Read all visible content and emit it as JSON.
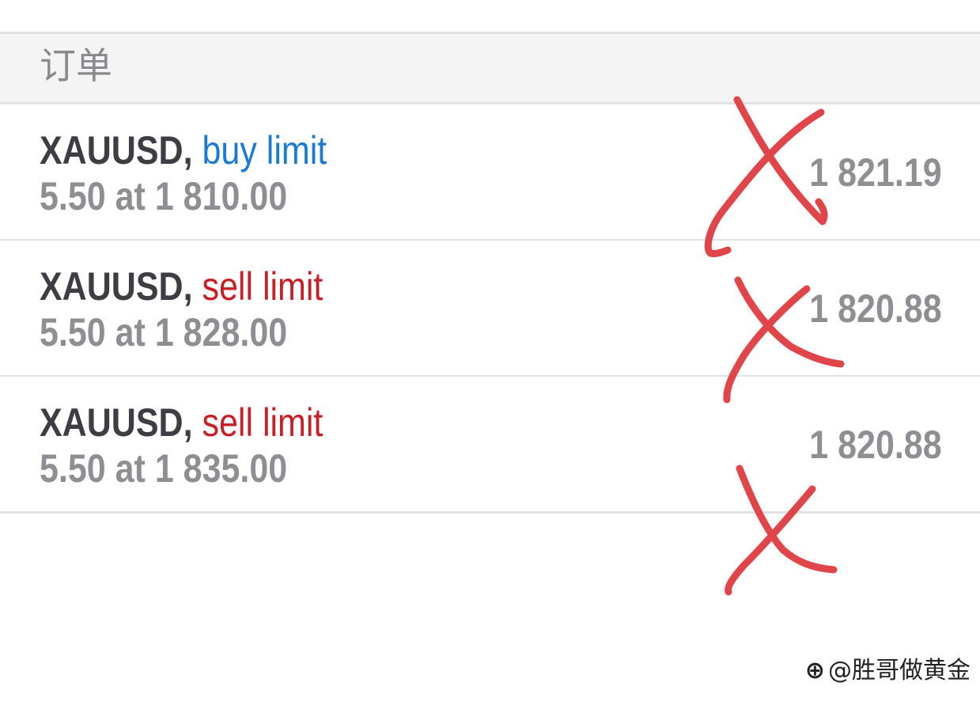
{
  "header": {
    "title": "订单"
  },
  "orders": [
    {
      "symbol": "XAUUSD,",
      "type": "buy limit",
      "detail": "5.50 at 1 810.00",
      "price": "1 821.19"
    },
    {
      "symbol": "XAUUSD,",
      "type": "sell limit",
      "detail": "5.50 at 1 828.00",
      "price": "1 820.88"
    },
    {
      "symbol": "XAUUSD,",
      "type": "sell limit",
      "detail": "5.50 at 1 835.00",
      "price": "1 820.88"
    }
  ],
  "colors": {
    "buy": "#1a7ad4",
    "sell": "#c62026",
    "annotation": "#e0454a"
  },
  "watermark": {
    "icon": "weibo-icon",
    "text": "@胜哥做黄金"
  }
}
